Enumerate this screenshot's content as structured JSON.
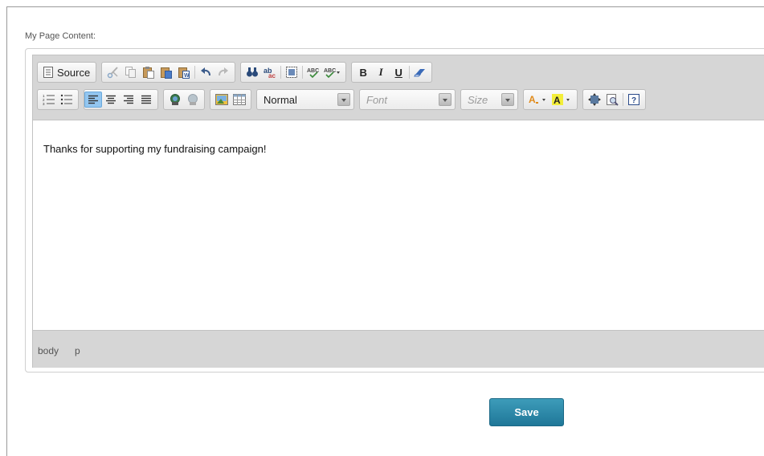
{
  "form": {
    "label": "My Page Content:",
    "save_label": "Save"
  },
  "toolbar": {
    "source_label": "Source",
    "format_value": "Normal",
    "font_placeholder": "Font",
    "size_placeholder": "Size",
    "row1_icons": [
      "cut-icon",
      "copy-icon",
      "paste-icon",
      "paste-text-icon",
      "paste-word-icon",
      "undo-icon",
      "redo-icon",
      "find-icon",
      "replace-icon",
      "select-all-icon",
      "spellcheck-icon",
      "spellcheck-as-you-type-icon",
      "bold-icon",
      "italic-icon",
      "underline-icon",
      "remove-format-icon"
    ],
    "row2_icons": [
      "numbered-list-icon",
      "bulleted-list-icon",
      "align-left-icon",
      "align-center-icon",
      "align-right-icon",
      "justify-icon",
      "link-icon",
      "unlink-icon",
      "image-icon",
      "table-icon",
      "text-color-icon",
      "background-color-icon",
      "maximize-icon",
      "preview-icon",
      "about-icon"
    ],
    "active": "align-left-icon"
  },
  "editor": {
    "content": "Thanks for supporting my fundraising campaign!",
    "path": [
      "body",
      "p"
    ]
  },
  "colors": {
    "accent": "#2a87a8",
    "active_button": "#93c6f0",
    "toolbar_bg": "#d6d6d6"
  }
}
